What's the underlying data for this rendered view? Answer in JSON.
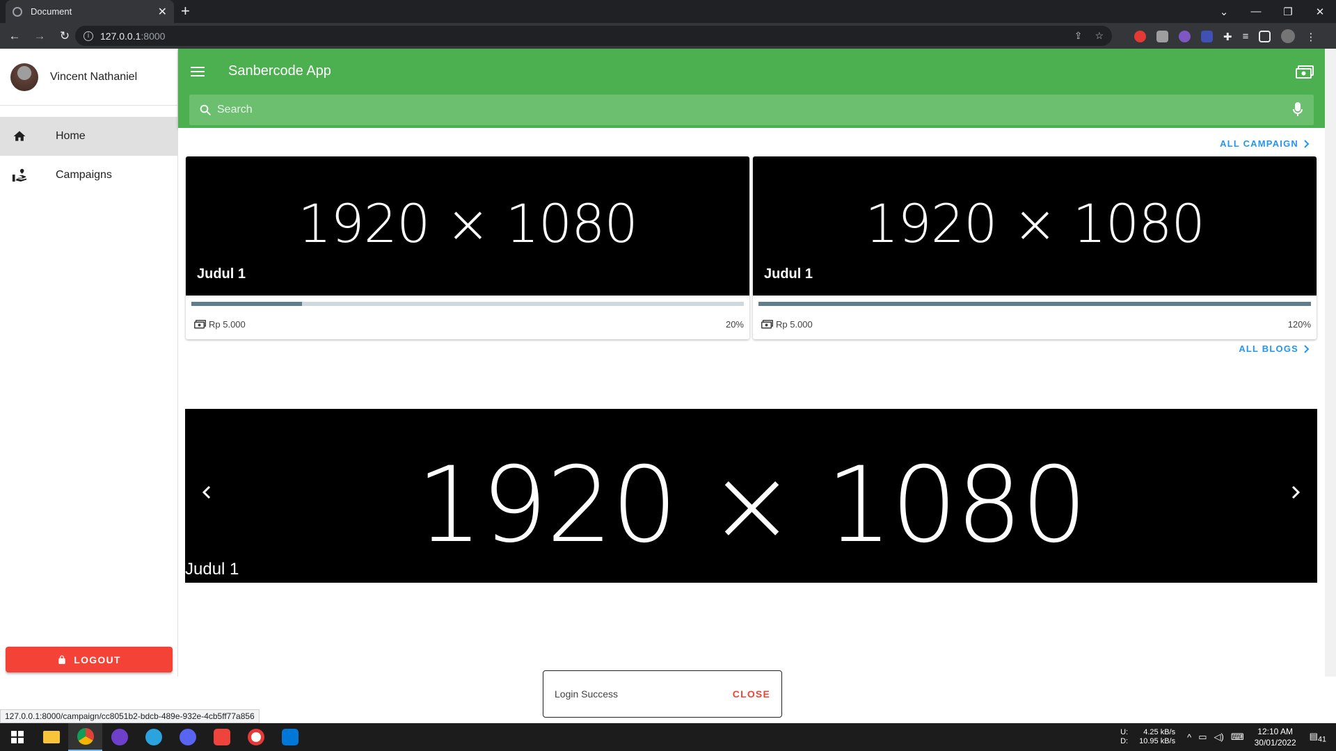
{
  "browser": {
    "tab_title": "Document",
    "tab_close": "✕",
    "new_tab": "+",
    "url_host": "127.0.0.1",
    "url_port": ":8000",
    "status_url": "127.0.0.1:8000/campaign/cc8051b2-bdcb-489e-932e-4cb5ff77a856"
  },
  "sidebar": {
    "user_name": "Vincent Nathaniel",
    "items": [
      {
        "label": "Home",
        "icon": "home-icon",
        "active": true
      },
      {
        "label": "Campaigns",
        "icon": "campaigns-icon",
        "active": false
      }
    ],
    "logout_label": "LOGOUT"
  },
  "appbar": {
    "title": "Sanbercode App",
    "search_placeholder": "Search"
  },
  "main": {
    "campaign_link": "ALL CAMPAIGN",
    "blogs_link": "ALL BLOGS",
    "campaigns": [
      {
        "image_text": "1920 × 1080",
        "title": "Judul 1",
        "amount": "Rp 5.000",
        "progress_label": "20%",
        "progress": 0.2
      },
      {
        "image_text": "1920 × 1080",
        "title": "Judul 1",
        "amount": "Rp 5.000",
        "progress_label": "120%",
        "progress": 1.0
      }
    ],
    "blog_carousel": {
      "image_text": "1920 × 1080",
      "title": "Judul 1"
    }
  },
  "snackbar": {
    "text": "Login Success",
    "close_label": "CLOSE"
  },
  "taskbar": {
    "net_up_label": "U:",
    "net_up": "4.25 kB/s",
    "net_down_label": "D:",
    "net_down": "10.95 kB/s",
    "time": "12:10 AM",
    "date": "30/01/2022",
    "notification_count": "41"
  },
  "colors": {
    "primary": "#4caf50",
    "logout": "#f44336",
    "link": "#2196f3",
    "progress": "#607d8b"
  }
}
